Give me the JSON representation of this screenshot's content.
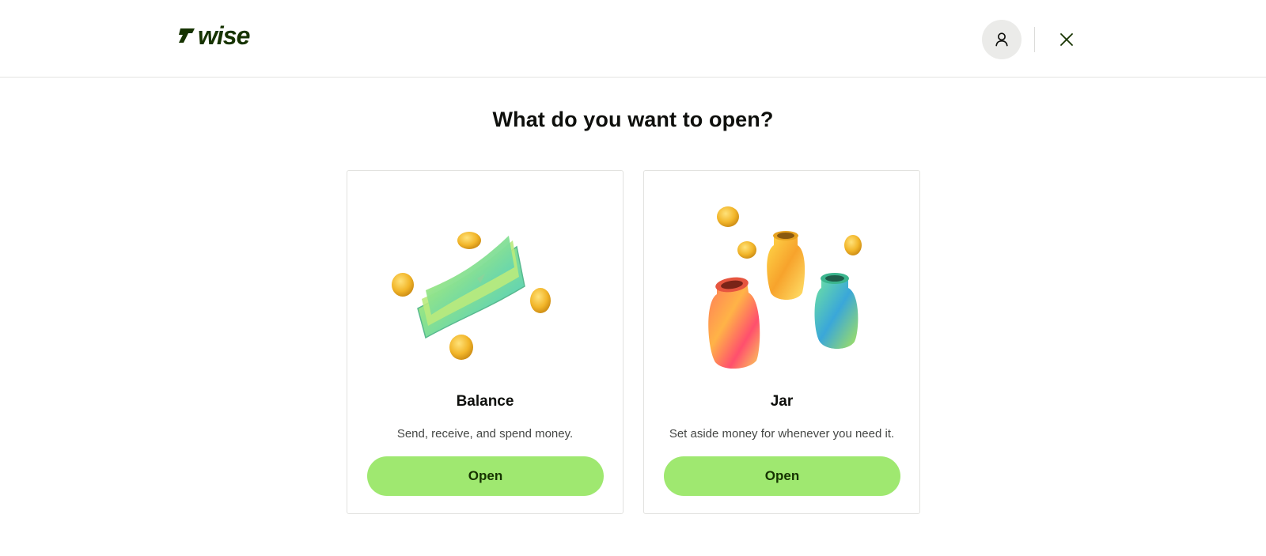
{
  "header": {
    "logo_text": "WISE",
    "profile_icon": "user-icon",
    "close_icon": "close-icon"
  },
  "main": {
    "title": "What do you want to open?",
    "cards": [
      {
        "title": "Balance",
        "description": "Send, receive, and spend money.",
        "button_label": "Open",
        "illustration": "money-bills-coins"
      },
      {
        "title": "Jar",
        "description": "Set aside money for whenever you need it.",
        "button_label": "Open",
        "illustration": "colorful-jars-coins"
      }
    ]
  },
  "colors": {
    "brand_dark": "#163300",
    "button_green": "#9fe870",
    "text": "#0e0f0c",
    "muted_text": "#454745"
  }
}
